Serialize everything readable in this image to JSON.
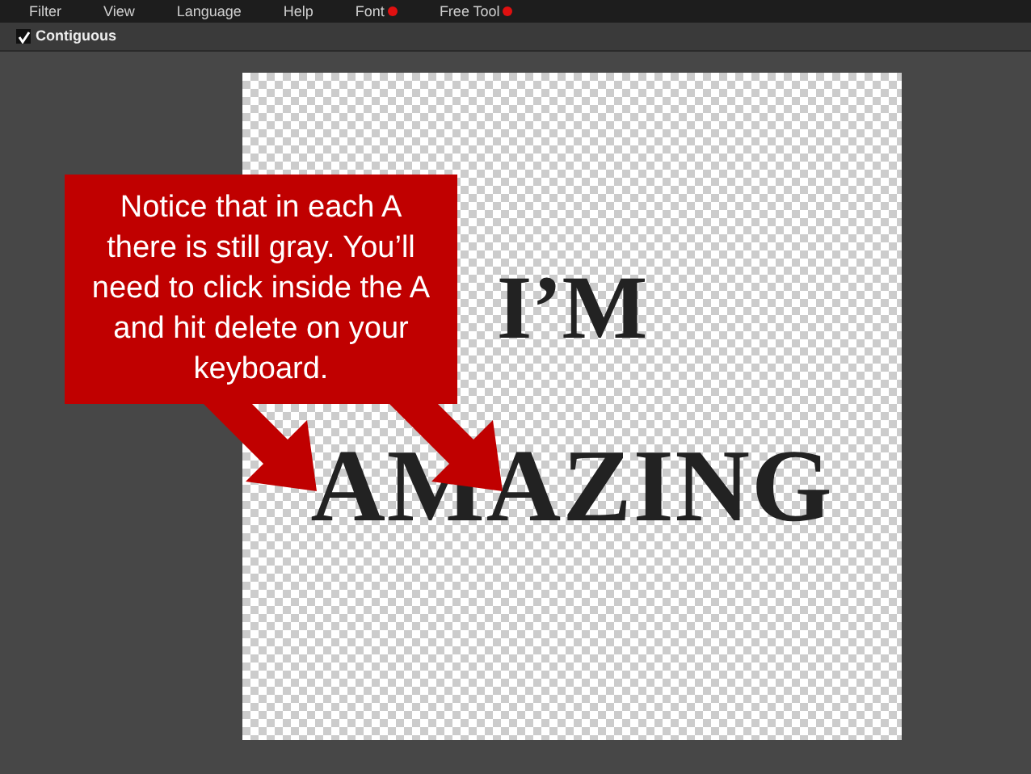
{
  "menu": [
    {
      "label": "Filter",
      "marked": false
    },
    {
      "label": "View",
      "marked": false
    },
    {
      "label": "Language",
      "marked": false
    },
    {
      "label": "Help",
      "marked": false
    },
    {
      "label": "Font",
      "marked": true
    },
    {
      "label": "Free Tool",
      "marked": true
    }
  ],
  "toolbar": {
    "option": {
      "label": "Contiguous",
      "checked": true
    }
  },
  "canvas": {
    "lines": [
      "I’M",
      "AMAZING"
    ]
  },
  "callout": {
    "text": "Notice that in each A there is still gray. You’ll need to click inside the A and hit delete on your keyboard."
  }
}
